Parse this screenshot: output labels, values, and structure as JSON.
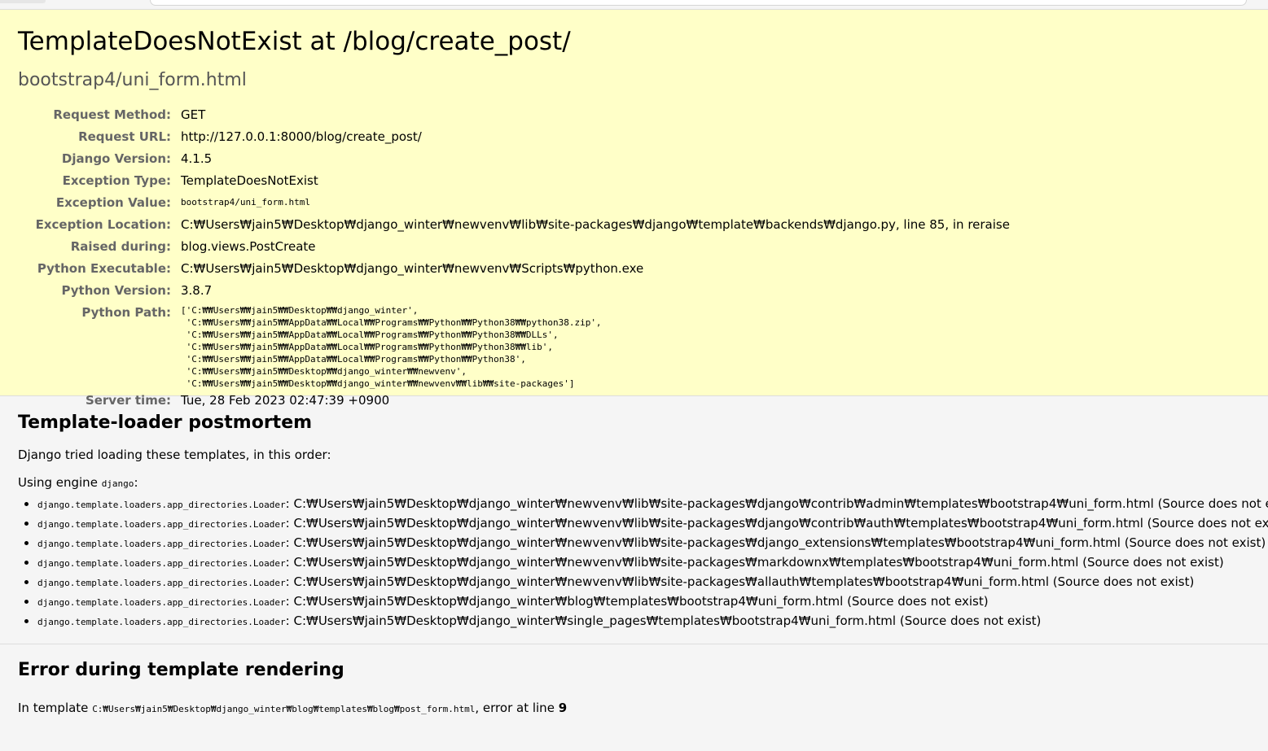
{
  "title": "TemplateDoesNotExist at /blog/create_post/",
  "subtitle": "bootstrap4/uni_form.html",
  "meta": [
    {
      "label": "Request Method:",
      "value": "GET"
    },
    {
      "label": "Request URL:",
      "value": "http://127.0.0.1:8000/blog/create_post/"
    },
    {
      "label": "Django Version:",
      "value": "4.1.5"
    },
    {
      "label": "Exception Type:",
      "value": "TemplateDoesNotExist"
    },
    {
      "label": "Exception Value:",
      "value": "bootstrap4/uni_form.html"
    },
    {
      "label": "Exception Location:",
      "value": "C:₩Users₩jain5₩Desktop₩django_winter₩newvenv₩lib₩site-packages₩django₩template₩backends₩django.py, line 85, in reraise"
    },
    {
      "label": "Raised during:",
      "value": "blog.views.PostCreate"
    },
    {
      "label": "Python Executable:",
      "value": "C:₩Users₩jain5₩Desktop₩django_winter₩newvenv₩Scripts₩python.exe"
    },
    {
      "label": "Python Version:",
      "value": "3.8.7"
    },
    {
      "label": "Python Path:",
      "value": "['C:₩₩Users₩₩jain5₩₩Desktop₩₩django_winter',\n 'C:₩₩Users₩₩jain5₩₩AppData₩₩Local₩₩Programs₩₩Python₩₩Python38₩₩python38.zip',\n 'C:₩₩Users₩₩jain5₩₩AppData₩₩Local₩₩Programs₩₩Python₩₩Python38₩₩DLLs',\n 'C:₩₩Users₩₩jain5₩₩AppData₩₩Local₩₩Programs₩₩Python₩₩Python38₩₩lib',\n 'C:₩₩Users₩₩jain5₩₩AppData₩₩Local₩₩Programs₩₩Python₩₩Python38',\n 'C:₩₩Users₩₩jain5₩₩Desktop₩₩django_winter₩₩newvenv',\n 'C:₩₩Users₩₩jain5₩₩Desktop₩₩django_winter₩₩newvenv₩₩lib₩₩site-packages']"
    },
    {
      "label": "Server time:",
      "value": "Tue, 28 Feb 2023 02:47:39 +0900"
    }
  ],
  "postmortem": {
    "heading": "Template-loader postmortem",
    "intro": "Django tried loading these templates, in this order:",
    "engine_prefix": "Using engine ",
    "engine_name": "django",
    "engine_suffix": ":",
    "loader": "django.template.loaders.app_directories.Loader",
    "items": [
      {
        "path": "C:₩Users₩jain5₩Desktop₩django_winter₩newvenv₩lib₩site-packages₩django₩contrib₩admin₩templates₩bootstrap4₩uni_form.html",
        "status": "(Source does not exist)"
      },
      {
        "path": "C:₩Users₩jain5₩Desktop₩django_winter₩newvenv₩lib₩site-packages₩django₩contrib₩auth₩templates₩bootstrap4₩uni_form.html",
        "status": "(Source does not exist)"
      },
      {
        "path": "C:₩Users₩jain5₩Desktop₩django_winter₩newvenv₩lib₩site-packages₩django_extensions₩templates₩bootstrap4₩uni_form.html",
        "status": "(Source does not exist)"
      },
      {
        "path": "C:₩Users₩jain5₩Desktop₩django_winter₩newvenv₩lib₩site-packages₩markdownx₩templates₩bootstrap4₩uni_form.html",
        "status": "(Source does not exist)"
      },
      {
        "path": "C:₩Users₩jain5₩Desktop₩django_winter₩newvenv₩lib₩site-packages₩allauth₩templates₩bootstrap4₩uni_form.html",
        "status": "(Source does not exist)"
      },
      {
        "path": "C:₩Users₩jain5₩Desktop₩django_winter₩blog₩templates₩bootstrap4₩uni_form.html",
        "status": "(Source does not exist)"
      },
      {
        "path": "C:₩Users₩jain5₩Desktop₩django_winter₩single_pages₩templates₩bootstrap4₩uni_form.html",
        "status": "(Source does not exist)"
      }
    ]
  },
  "template_error": {
    "heading": "Error during template rendering",
    "prefix": "In template ",
    "template_path": "C:₩Users₩jain5₩Desktop₩django_winter₩blog₩templates₩blog₩post_form.html",
    "middle": ", error at line ",
    "line": "9"
  }
}
